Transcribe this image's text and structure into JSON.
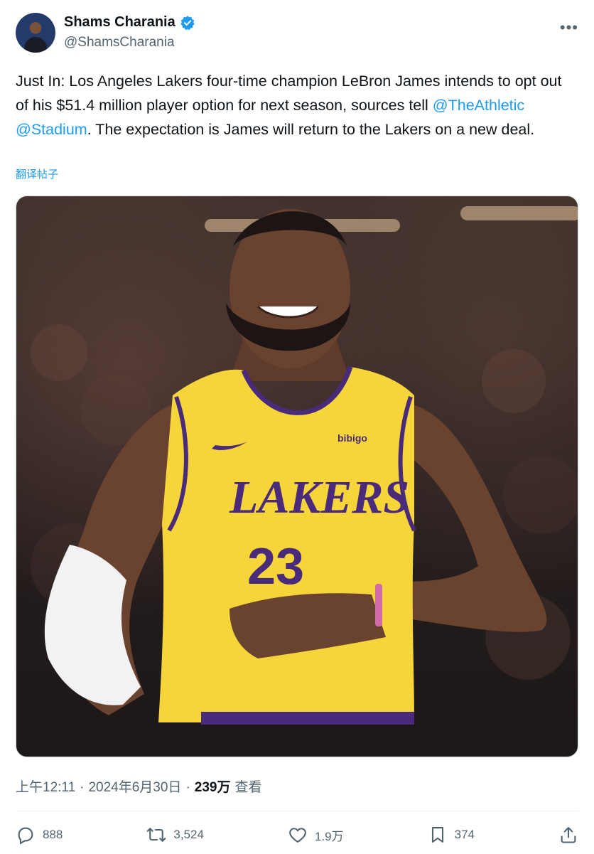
{
  "author": {
    "display_name": "Shams Charania",
    "handle": "@ShamsCharania"
  },
  "tweet": {
    "text_part1": "Just In: Los Angeles Lakers four-time champion LeBron James intends to opt out of his $51.4 million player option for next season, sources tell ",
    "mention1": "@TheAthletic",
    "space": " ",
    "mention2": "@Stadium",
    "text_part2": ". The expectation is James will return to the Lakers on a new deal.",
    "translate_label": "翻译帖子"
  },
  "media": {
    "jersey_brand": "LAKERS",
    "jersey_number": "23",
    "sponsor": "bibigo"
  },
  "meta": {
    "time": "上午12:11",
    "separator": "·",
    "date": "2024年6月30日",
    "separator2": "·",
    "views": "239万",
    "views_label": "查看"
  },
  "actions": {
    "reply_count": "888",
    "repost_count": "3,524",
    "like_count": "1.9万",
    "bookmark_count": "374"
  },
  "colors": {
    "accent": "#1d9bf0",
    "muted": "#536471",
    "jersey_gold": "#f6d53a",
    "jersey_purple": "#4a2a7a"
  }
}
